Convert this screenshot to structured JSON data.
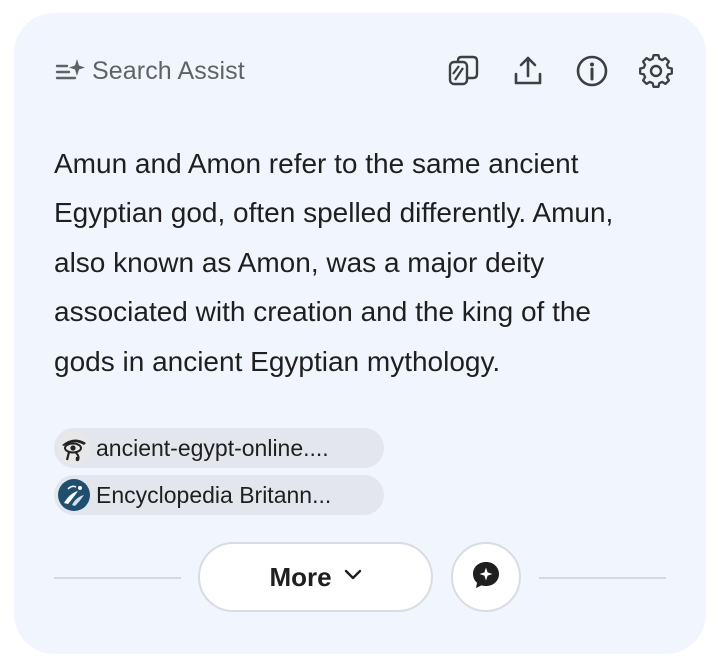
{
  "header": {
    "title": "Search Assist",
    "icons": {
      "brand": "sparkle-list-icon",
      "copy": "copy-icon",
      "share": "share-icon",
      "info": "info-icon",
      "settings": "gear-icon"
    }
  },
  "answer": {
    "text": "Amun and Amon refer to the same ancient Egyptian god, often spelled differently. Amun, also known as Amon, was a major deity associated with creation and the king of the gods in ancient Egyptian mythology."
  },
  "sources": [
    {
      "label": "ancient-egypt-online....",
      "favicon": "eye-of-horus-icon"
    },
    {
      "label": "Encyclopedia Britann...",
      "favicon": "britannica-thistle-icon"
    }
  ],
  "footer": {
    "more_label": "More",
    "more_icon": "chevron-down-icon",
    "chat_icon": "chat-sparkle-icon"
  },
  "colors": {
    "card_background": "#f1f5fd",
    "text_primary": "#1f1f1f",
    "text_secondary": "#5f6368",
    "chip_background": "#e3e6ec"
  }
}
